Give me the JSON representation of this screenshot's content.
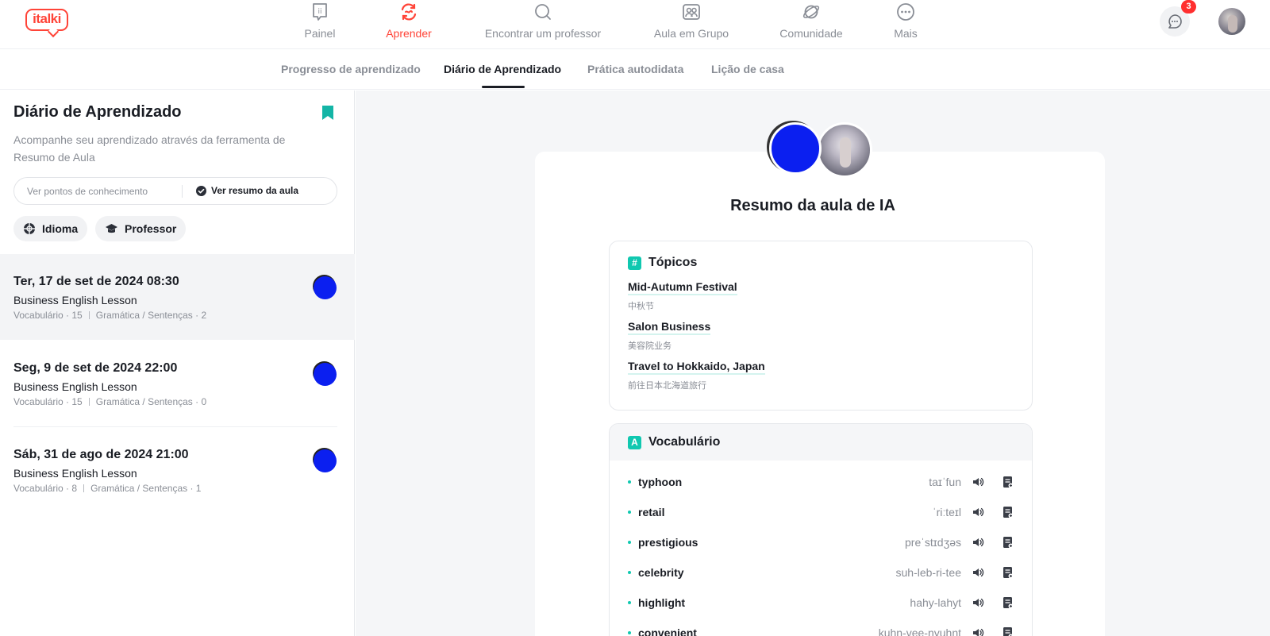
{
  "brand": {
    "logo_text": "italki",
    "accent": "#ff4438"
  },
  "topnav": {
    "items": [
      {
        "label": "Painel",
        "icon": "dashboard-icon"
      },
      {
        "label": "Aprender",
        "icon": "learn-icon",
        "active": true
      },
      {
        "label": "Encontrar um professor",
        "icon": "search-icon"
      },
      {
        "label": "Aula em Grupo",
        "icon": "group-class-icon"
      },
      {
        "label": "Comunidade",
        "icon": "planet-icon"
      },
      {
        "label": "Mais",
        "icon": "more-icon"
      }
    ],
    "messages_badge": "3"
  },
  "subnav": {
    "tabs": [
      {
        "label": "Progresso de aprendizado"
      },
      {
        "label": "Diário de Aprendizado",
        "active": true
      },
      {
        "label": "Prática autodidata"
      },
      {
        "label": "Lição de casa"
      }
    ]
  },
  "sidebar": {
    "title": "Diário de Aprendizado",
    "description": "Acompanhe seu aprendizado através da ferramenta de Resumo de Aula",
    "toggle": {
      "option1": "Ver pontos de conhecimento",
      "option2": "Ver resumo da aula"
    },
    "filters": {
      "language": "Idioma",
      "teacher": "Professor"
    },
    "lessons": [
      {
        "date": "Ter, 17 de set de 2024 08:30",
        "name": "Business English Lesson",
        "vocab": "Vocabulário · 15",
        "grammar": "Gramática / Sentenças · 2",
        "selected": true
      },
      {
        "date": "Seg, 9 de set de 2024 22:00",
        "name": "Business English Lesson",
        "vocab": "Vocabulário · 15",
        "grammar": "Gramática / Sentenças · 0"
      },
      {
        "date": "Sáb, 31 de ago de 2024 21:00",
        "name": "Business English Lesson",
        "vocab": "Vocabulário · 8",
        "grammar": "Gramática / Sentenças · 1"
      }
    ]
  },
  "summary": {
    "title": "Resumo da aula de IA",
    "topics": {
      "heading": "Tópicos",
      "icon_glyph": "#",
      "items": [
        {
          "title": "Mid-Autumn Festival",
          "translation": "中秋节"
        },
        {
          "title": "Salon Business",
          "translation": "美容院业务"
        },
        {
          "title": "Travel to Hokkaido, Japan",
          "translation": "前往日本北海道旅行"
        }
      ]
    },
    "vocabulary": {
      "heading": "Vocabulário",
      "icon_glyph": "A",
      "items": [
        {
          "word": "typhoon",
          "pron": "taɪˈfun"
        },
        {
          "word": "retail",
          "pron": "ˈriːteɪl"
        },
        {
          "word": "prestigious",
          "pron": "preˈstɪdʒəs"
        },
        {
          "word": "celebrity",
          "pron": "suh-leb-ri-tee"
        },
        {
          "word": "highlight",
          "pron": "hahy-lahyt"
        },
        {
          "word": "convenient",
          "pron": "kuhn-vee-nyuhnt"
        }
      ]
    }
  }
}
